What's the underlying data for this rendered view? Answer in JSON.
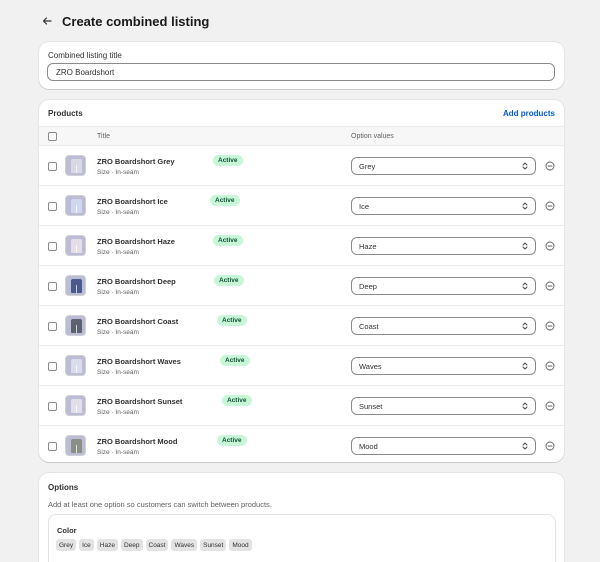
{
  "page": {
    "title": "Create combined listing",
    "back_icon": "arrow-left-icon"
  },
  "title_card": {
    "label": "Combined listing title",
    "value": "ZRO Boardshort"
  },
  "products": {
    "heading": "Products",
    "add_link": "Add products",
    "columns": {
      "title": "Title",
      "option_values": "Option values"
    },
    "rows": [
      {
        "name": "ZRO Boardshort Grey",
        "status": "Active",
        "subtitle": "Size · In-seam",
        "option": "Grey",
        "thumb_color": "#d9d9e6"
      },
      {
        "name": "ZRO Boardshort Ice",
        "status": "Active",
        "subtitle": "Size · In-seam",
        "option": "Ice",
        "thumb_color": "#cfd8f0"
      },
      {
        "name": "ZRO Boardshort Haze",
        "status": "Active",
        "subtitle": "Size · In-seam",
        "option": "Haze",
        "thumb_color": "#e6dde6"
      },
      {
        "name": "ZRO Boardshort Deep",
        "status": "Active",
        "subtitle": "Size · In-seam",
        "option": "Deep",
        "thumb_color": "#4a5a8c"
      },
      {
        "name": "ZRO Boardshort Coast",
        "status": "Active",
        "subtitle": "Size · In-seam",
        "option": "Coast",
        "thumb_color": "#5a6270"
      },
      {
        "name": "ZRO Boardshort Waves",
        "status": "Active",
        "subtitle": "Size · In-seam",
        "option": "Waves",
        "thumb_color": "#d8dcec"
      },
      {
        "name": "ZRO Boardshort Sunset",
        "status": "Active",
        "subtitle": "Size · In-seam",
        "option": "Sunset",
        "thumb_color": "#e2dfe8"
      },
      {
        "name": "ZRO Boardshort Mood",
        "status": "Active",
        "subtitle": "Size · In-seam",
        "option": "Mood",
        "thumb_color": "#8a9088"
      }
    ]
  },
  "options": {
    "heading": "Options",
    "help": "Add at least one option so customers can switch between products.",
    "option_name": "Color",
    "values": [
      "Grey",
      "Ice",
      "Haze",
      "Deep",
      "Coast",
      "Waves",
      "Sunset",
      "Mood"
    ]
  },
  "colors": {
    "badge_bg": "#c8f7d7",
    "badge_text": "#0c5132",
    "link": "#005bd3",
    "page_bg": "#f1f1f1"
  }
}
